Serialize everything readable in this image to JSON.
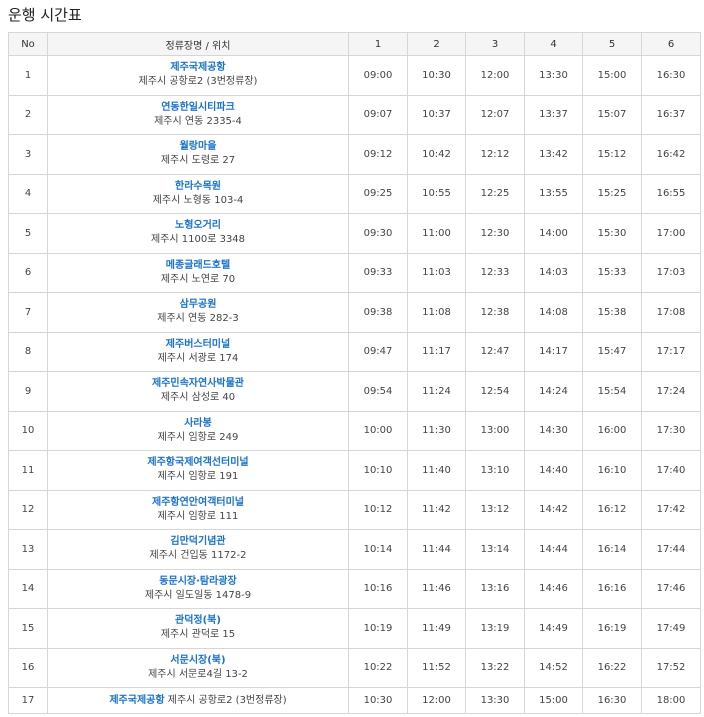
{
  "page_title": "운행 시간표",
  "columns": {
    "no": "No",
    "stop": "정류장명 / 위치",
    "trips": [
      "1",
      "2",
      "3",
      "4",
      "5",
      "6"
    ]
  },
  "rows": [
    {
      "no": "1",
      "name": "제주국제공항",
      "addr": "제주시 공항로2 (3번정류장)",
      "times": [
        "09:00",
        "10:30",
        "12:00",
        "13:30",
        "15:00",
        "16:30"
      ]
    },
    {
      "no": "2",
      "name": "연동한일시티파크",
      "addr": "제주시 연동 2335-4",
      "times": [
        "09:07",
        "10:37",
        "12:07",
        "13:37",
        "15:07",
        "16:37"
      ]
    },
    {
      "no": "3",
      "name": "월랑마을",
      "addr": "제주시 도령로 27",
      "times": [
        "09:12",
        "10:42",
        "12:12",
        "13:42",
        "15:12",
        "16:42"
      ]
    },
    {
      "no": "4",
      "name": "한라수목원",
      "addr": "제주시 노형동 103-4",
      "times": [
        "09:25",
        "10:55",
        "12:25",
        "13:55",
        "15:25",
        "16:55"
      ]
    },
    {
      "no": "5",
      "name": "노형오거리",
      "addr": "제주시 1100로 3348",
      "times": [
        "09:30",
        "11:00",
        "12:30",
        "14:00",
        "15:30",
        "17:00"
      ]
    },
    {
      "no": "6",
      "name": "메종글래드호텔",
      "addr": "제주시 노연로 70",
      "times": [
        "09:33",
        "11:03",
        "12:33",
        "14:03",
        "15:33",
        "17:03"
      ]
    },
    {
      "no": "7",
      "name": "삼무공원",
      "addr": "제주시 연동 282-3",
      "times": [
        "09:38",
        "11:08",
        "12:38",
        "14:08",
        "15:38",
        "17:08"
      ]
    },
    {
      "no": "8",
      "name": "제주버스터미널",
      "addr": "제주시 서광로 174",
      "times": [
        "09:47",
        "11:17",
        "12:47",
        "14:17",
        "15:47",
        "17:17"
      ]
    },
    {
      "no": "9",
      "name": "제주민속자연사박물관",
      "addr": "제주시 삼성로 40",
      "times": [
        "09:54",
        "11:24",
        "12:54",
        "14:24",
        "15:54",
        "17:24"
      ]
    },
    {
      "no": "10",
      "name": "사라봉",
      "addr": "제주시 임항로 249",
      "times": [
        "10:00",
        "11:30",
        "13:00",
        "14:30",
        "16:00",
        "17:30"
      ]
    },
    {
      "no": "11",
      "name": "제주항국제여객선터미널",
      "addr": "제주시 임항로 191",
      "times": [
        "10:10",
        "11:40",
        "13:10",
        "14:40",
        "16:10",
        "17:40"
      ]
    },
    {
      "no": "12",
      "name": "제주항연안여객터미널",
      "addr": "제주시 임항로 111",
      "times": [
        "10:12",
        "11:42",
        "13:12",
        "14:42",
        "16:12",
        "17:42"
      ]
    },
    {
      "no": "13",
      "name": "김만덕기념관",
      "addr": "제주시 건입동 1172-2",
      "times": [
        "10:14",
        "11:44",
        "13:14",
        "14:44",
        "16:14",
        "17:44"
      ]
    },
    {
      "no": "14",
      "name": "동문시장·탐라광장",
      "addr": "제주시 일도일동 1478-9",
      "times": [
        "10:16",
        "11:46",
        "13:16",
        "14:46",
        "16:16",
        "17:46"
      ]
    },
    {
      "no": "15",
      "name": "관덕정(북)",
      "addr": "제주시 관덕로 15",
      "times": [
        "10:19",
        "11:49",
        "13:19",
        "14:49",
        "16:19",
        "17:49"
      ]
    },
    {
      "no": "16",
      "name": "서문시장(북)",
      "addr": "제주시 서문로4길 13-2",
      "times": [
        "10:22",
        "11:52",
        "13:22",
        "14:52",
        "16:22",
        "17:52"
      ]
    },
    {
      "no": "17",
      "name": "제주국제공항",
      "addr": "제주시 공항로2 (3번정류장)",
      "times": [
        "10:30",
        "12:00",
        "13:30",
        "15:00",
        "16:30",
        "18:00"
      ]
    }
  ]
}
